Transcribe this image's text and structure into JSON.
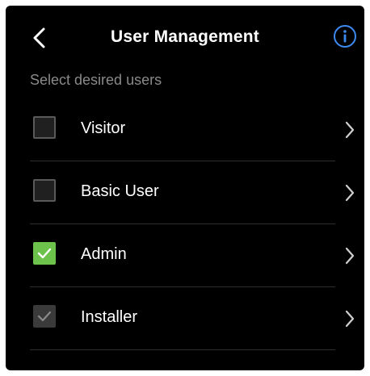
{
  "header": {
    "title": "User Management",
    "back_icon": "chevron-left-icon",
    "info_icon": "info-circle-icon"
  },
  "subtitle": "Select desired users",
  "users": [
    {
      "label": "Visitor",
      "checked": false,
      "disabled": false
    },
    {
      "label": "Basic User",
      "checked": false,
      "disabled": false
    },
    {
      "label": "Admin",
      "checked": true,
      "disabled": false
    },
    {
      "label": "Installer",
      "checked": true,
      "disabled": true
    }
  ],
  "colors": {
    "background": "#000000",
    "accent_green": "#6cc24a",
    "info_blue": "#3d8bf2",
    "muted_text": "#8a8a8a"
  }
}
